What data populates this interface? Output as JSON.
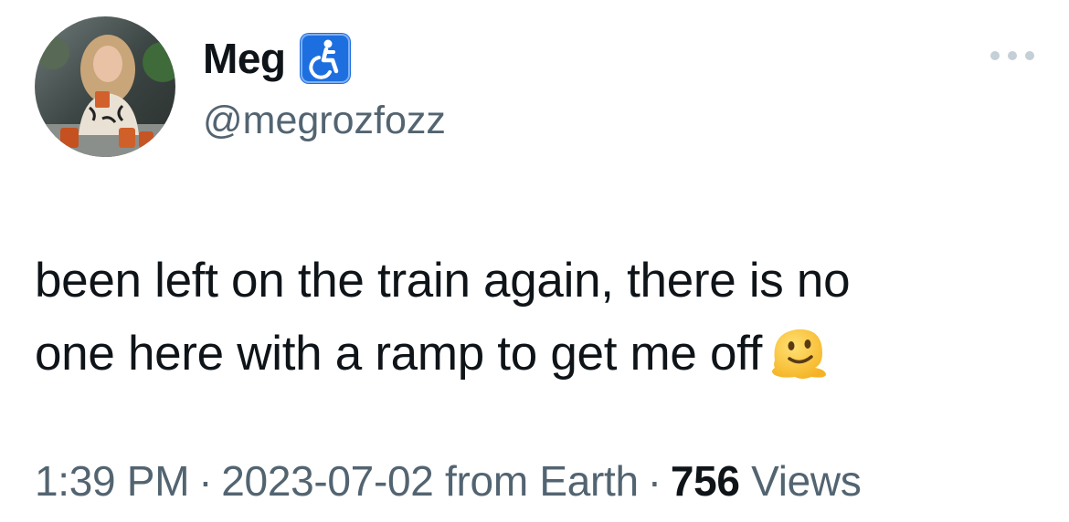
{
  "tweet": {
    "author": {
      "display_name": "Meg",
      "badge_icon": "accessibility-icon",
      "handle": "@megrozfozz"
    },
    "more_icon": "more-options-icon",
    "text_line1": "been left on the train again, there is no",
    "text_line2": "one here with a ramp to get me off",
    "emoji": "melting-face-icon",
    "time": "1:39 PM",
    "date": "2023-07-02",
    "source": "from Earth",
    "separator": "·",
    "views_count": "756",
    "views_label": "Views"
  },
  "colors": {
    "text": "#0f1419",
    "secondary": "#536471",
    "badge_blue": "#1d6fe0",
    "dots": "#c4cfd6"
  }
}
